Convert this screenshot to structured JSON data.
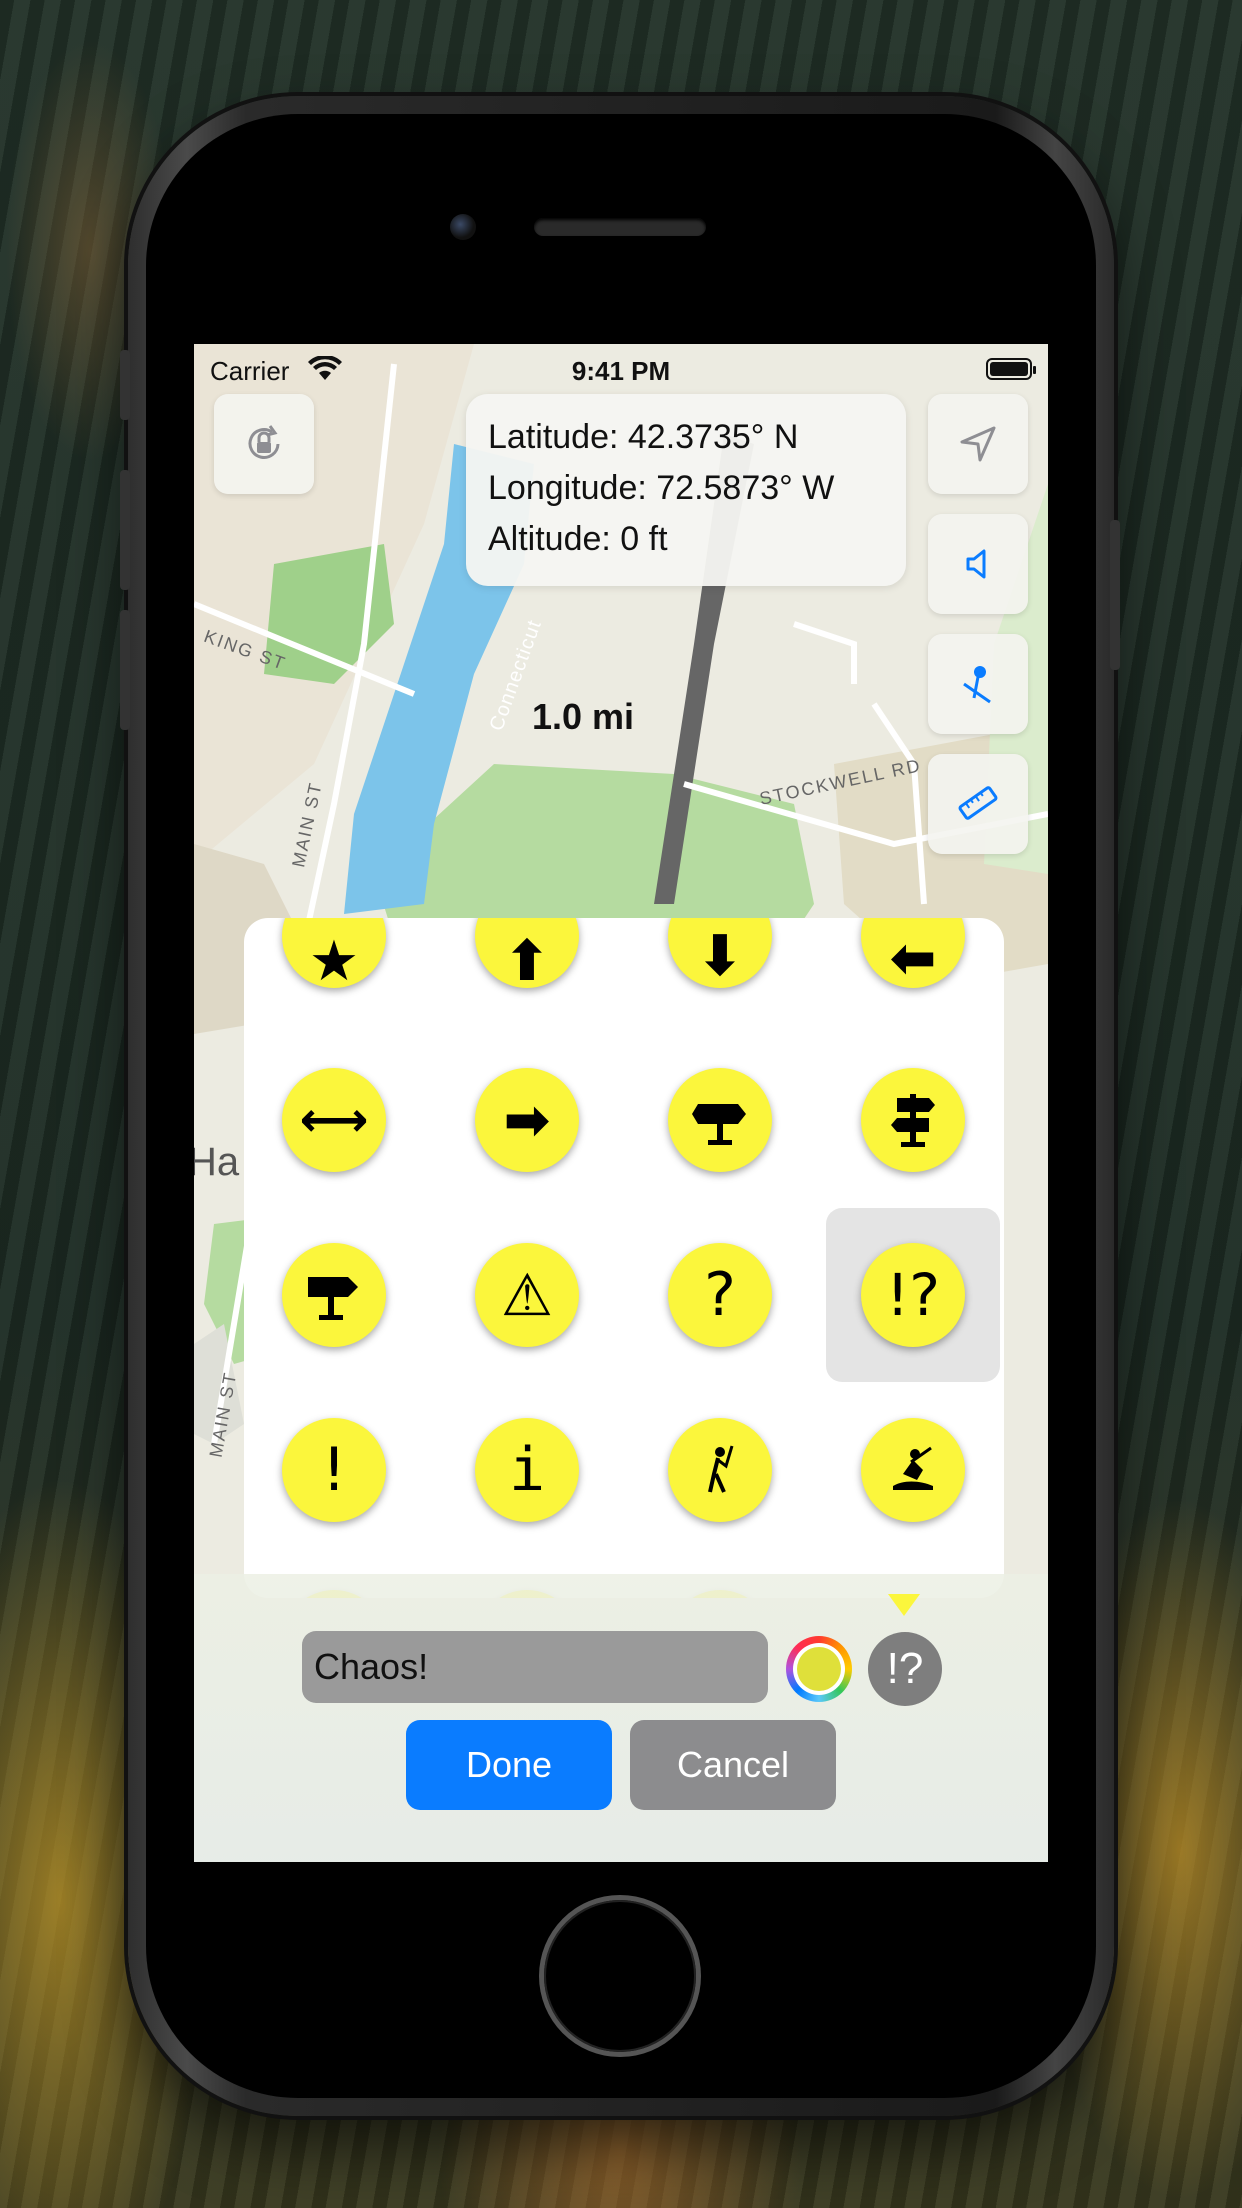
{
  "status_bar": {
    "carrier": "Carrier",
    "time": "9:41 PM"
  },
  "info": {
    "latitude": "Latitude: 42.3735° N",
    "longitude": "Longitude: 72.5873° W",
    "altitude": "Altitude: 0 ft"
  },
  "map": {
    "scale": "1.0 mi",
    "labels": {
      "king_st": "KING ST",
      "main_st": "MAIN ST",
      "main_st_2": "MAIN ST",
      "stockwell_rd": "STOCKWELL RD",
      "connecticut": "Connecticut",
      "town": "Ha"
    }
  },
  "map_controls": [
    {
      "name": "rotation-lock-icon"
    },
    {
      "name": "location-arrow-icon"
    },
    {
      "name": "speaker-icon"
    },
    {
      "name": "pin-icon"
    },
    {
      "name": "ruler-icon"
    }
  ],
  "symbols": {
    "row1": [
      "★",
      "⬆",
      "⬇",
      "⬅"
    ],
    "row2": [
      "⟷",
      "➡",
      "signpost",
      "signpost-2"
    ],
    "row3": [
      "signpost-3",
      "⚠",
      "?",
      "!?"
    ],
    "row4": [
      "!",
      "i",
      "golfer",
      "hunter"
    ],
    "selected": "!?",
    "color": "#fbf63c"
  },
  "editor": {
    "name_value": "Chaos!",
    "color": "#dfe03a",
    "symbol_preview": "!?",
    "done_label": "Done",
    "cancel_label": "Cancel"
  }
}
